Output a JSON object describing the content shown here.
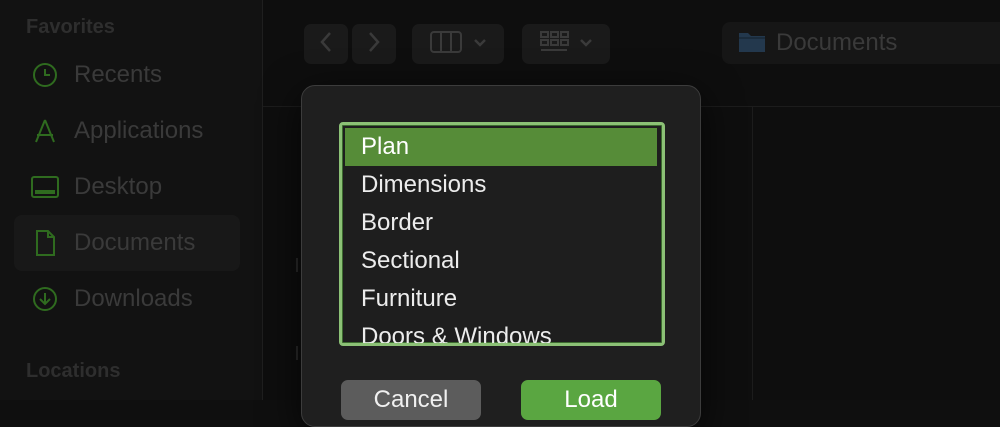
{
  "sidebar": {
    "favorites_heading": "Favorites",
    "locations_heading": "Locations",
    "items": [
      {
        "label": "Recents",
        "icon": "clock-icon"
      },
      {
        "label": "Applications",
        "icon": "applications-icon"
      },
      {
        "label": "Desktop",
        "icon": "desktop-icon"
      },
      {
        "label": "Documents",
        "icon": "document-icon",
        "selected": true
      },
      {
        "label": "Downloads",
        "icon": "download-icon"
      }
    ]
  },
  "toolbar": {
    "path_label": "Documents"
  },
  "dialog": {
    "list_items": [
      {
        "label": "Plan",
        "selected": true
      },
      {
        "label": "Dimensions"
      },
      {
        "label": "Border"
      },
      {
        "label": "Sectional"
      },
      {
        "label": "Furniture"
      },
      {
        "label": "Doors & Windows"
      }
    ],
    "cancel_label": "Cancel",
    "load_label": "Load"
  },
  "colors": {
    "accent": "#5aa641",
    "selection": "#568c38",
    "focus_ring": "#8cc176",
    "sidebar_icon": "#2f6b1f"
  }
}
